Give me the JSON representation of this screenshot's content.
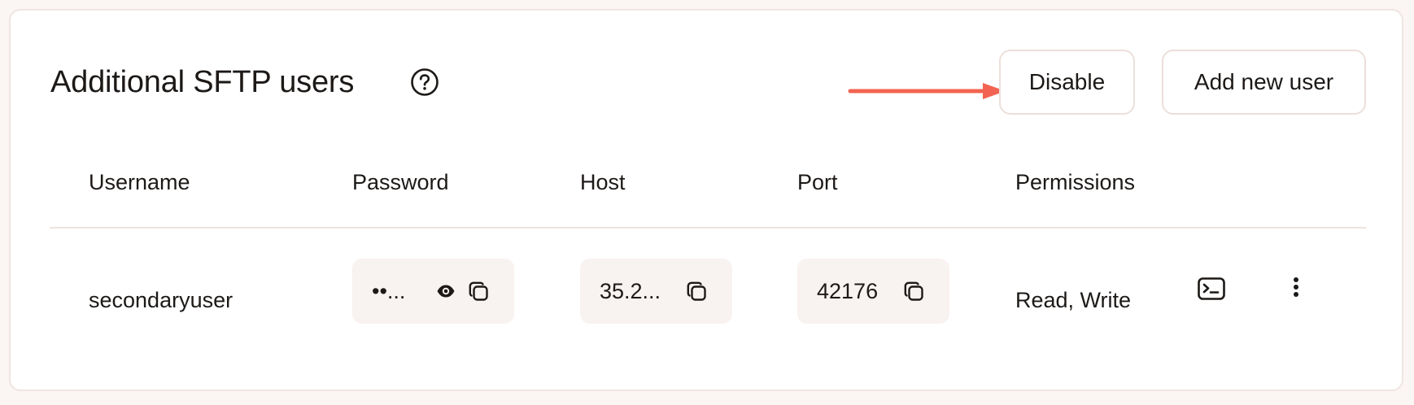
{
  "section": {
    "title": "Additional SFTP users",
    "help_icon": "question-circle-icon",
    "annotation_arrow_color": "#f26451"
  },
  "actions": {
    "disable_label": "Disable",
    "add_user_label": "Add new user"
  },
  "table": {
    "columns": [
      "Username",
      "Password",
      "Host",
      "Port",
      "Permissions"
    ],
    "rows": [
      {
        "username": "secondaryuser",
        "password": "••...",
        "host": "35.2...",
        "port": "42176",
        "permissions": "Read, Write",
        "icons": [
          "eye-icon",
          "copy-icon",
          "terminal-icon",
          "more-vertical-icon"
        ]
      }
    ]
  },
  "colors": {
    "pill_background": "#f8f2f0",
    "border": "#ece0db",
    "text": "#1c1917"
  }
}
